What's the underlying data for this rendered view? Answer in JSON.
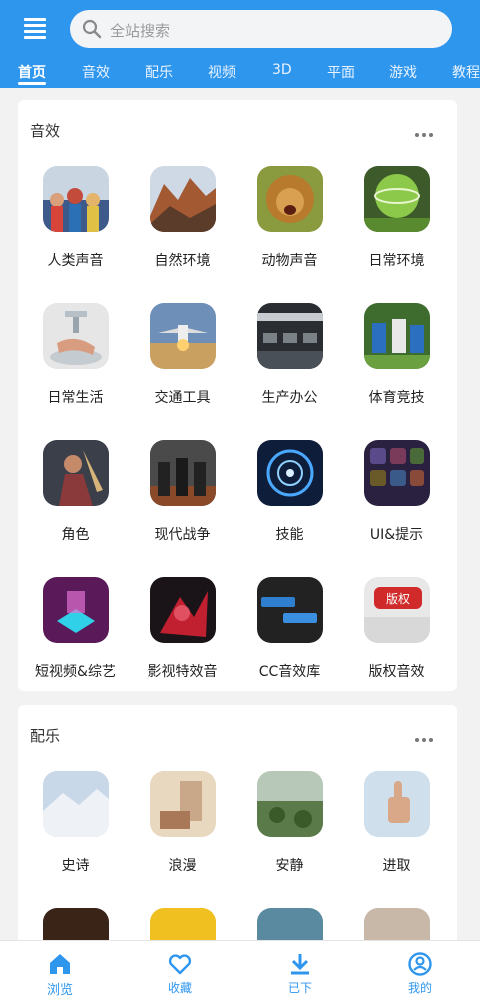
{
  "header": {
    "search_placeholder": "全站搜索",
    "tabs": [
      "首页",
      "音效",
      "配乐",
      "视频",
      "3D",
      "平面",
      "游戏",
      "教程"
    ],
    "active_tab": "首页"
  },
  "sections": [
    {
      "title": "音效",
      "items": [
        "人类声音",
        "自然环境",
        "动物声音",
        "日常环境",
        "日常生活",
        "交通工具",
        "生产办公",
        "体育竞技",
        "角色",
        "现代战争",
        "技能",
        "UI&提示",
        "短视频&综艺",
        "影视特效音",
        "CC音效库",
        "版权音效"
      ]
    },
    {
      "title": "配乐",
      "items": [
        "史诗",
        "浪漫",
        "安静",
        "进取"
      ]
    }
  ],
  "thumb_text": {
    "copyright_badge": "版权"
  },
  "bottom_nav": {
    "items": [
      "浏览",
      "收藏",
      "已下",
      "我的"
    ],
    "active": "浏览"
  },
  "colors": {
    "primary": "#2f96ee",
    "background": "#f2f2f2"
  }
}
